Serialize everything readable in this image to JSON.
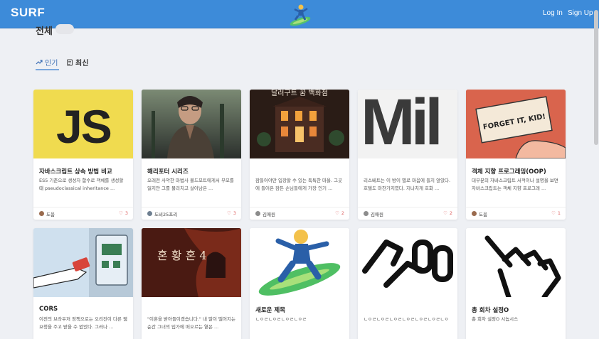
{
  "header": {
    "logo": "SURF",
    "nav_login": "Log In",
    "nav_signup": "Sign Up",
    "mascot_icon": "surfer-icon",
    "bg_color": "#3d8bd9"
  },
  "page": {
    "title": "전체"
  },
  "tabs": [
    {
      "label": "인기",
      "icon": "trending-icon",
      "active": true
    },
    {
      "label": "최신",
      "icon": "clock-icon",
      "active": false
    }
  ],
  "cards": [
    {
      "title": "자바스크립트 상속 방법 비교",
      "desc": "ES5 기준으로 생성자 함수로 객체를 생성할 때 pseudoclassical inheritance ...",
      "author": "도움",
      "likes": "3",
      "thumb_text": "JS"
    },
    {
      "title": "해리포터 시리즈",
      "desc": "오래전 사악한 마법사 볼드모트에게서 부모를 잃지만 그를 물리치고 살아남은 ...",
      "author": "도비25프리",
      "likes": "3"
    },
    {
      "title": "",
      "desc": "잠들어야만 입장할 수 있는 독특한 마을. 그곳에 들어온 잠든 손님들에게 가장 인기 ...",
      "author": "김애원",
      "likes": "2",
      "thumb_text": "달러구트 꿈 백화점"
    },
    {
      "title": "",
      "desc": "리스베트는 이 방이 별로 마음에 들지 않았다. 호텔도 마찬가지였다. 지나치게 호화 ...",
      "author": "김애원",
      "likes": "2",
      "thumb_text": "Mil"
    },
    {
      "title": "객체 지향 프로그래밍(OOP)",
      "desc": "대부분의 자바스크립트 서적이나 설명을 보면 자바스크립트는 객체 지향 프로그래 ...",
      "author": "도움",
      "likes": "1",
      "thumb_text": "FORGET IT, KID!"
    },
    {
      "title": "CORS",
      "desc": "이전의 브라우저 정책으로는 오리진이 다른 웹 요청을 주고 받을 수 없었다. 그러나 ..."
    },
    {
      "title": "",
      "desc": "\"이혼을 받아들이겠습니다.\" 내 말이 떨어지는 순간 그녀의 입가에 떠오르는 옅은 ...",
      "thumb_text": "혼 황 혼 4"
    },
    {
      "title": "새로운 제목",
      "desc": "ㄴㅇㄹㄴㅇㄹㄴㅇㄹㄴㅇㄹ"
    },
    {
      "title": "",
      "desc": "ㄴㅇㄹㄴㅇㄹㄴㅇㄹㄴㅇㄹㄴㅇㄹㄴㅇㄹㄴㅇ"
    },
    {
      "title": "총 회차 설정O",
      "desc": "총 회차 설정O 시놉시스"
    }
  ]
}
